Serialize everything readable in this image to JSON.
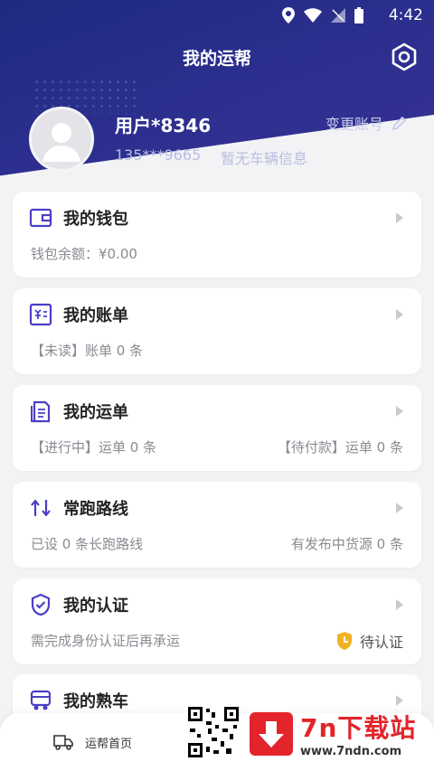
{
  "status": {
    "time": "4:42"
  },
  "header": {
    "title": "我的运帮"
  },
  "profile": {
    "username": "用户*8346",
    "phone": "135***9665",
    "vehicle_info": "暂无车辆信息",
    "change_account": "变更账号"
  },
  "cards": {
    "wallet": {
      "title": "我的钱包",
      "sub": "钱包余额：¥0.00"
    },
    "bill": {
      "title": "我的账单",
      "sub": "【未读】账单 0 条"
    },
    "waybill": {
      "title": "我的运单",
      "sub": "【进行中】运单 0 条",
      "sub_right": "【待付款】运单 0 条"
    },
    "route": {
      "title": "常跑路线",
      "sub": "已设 0 条长跑路线",
      "sub_right": "有发布中货源 0 条"
    },
    "cert": {
      "title": "我的认证",
      "sub": "需完成身份认证后再承运",
      "status": "待认证"
    },
    "familiar": {
      "title": "我的熟车"
    }
  },
  "bottom_nav": {
    "home": "运帮首页"
  },
  "watermark": {
    "brand": "7n下载站",
    "url": "www.7ndn.com"
  },
  "colors": {
    "accent": "#4b3fc6",
    "header_bg": "#2c2f8e",
    "warning": "#f0b323",
    "watermark_red": "#e3242b"
  },
  "icons": [
    "wifi-icon",
    "signal-icon",
    "battery-icon",
    "location-icon",
    "settings-icon",
    "edit-icon",
    "wallet-icon",
    "bill-icon",
    "waybill-icon",
    "route-icon",
    "shield-icon",
    "truck-icon",
    "clock-badge-icon"
  ]
}
